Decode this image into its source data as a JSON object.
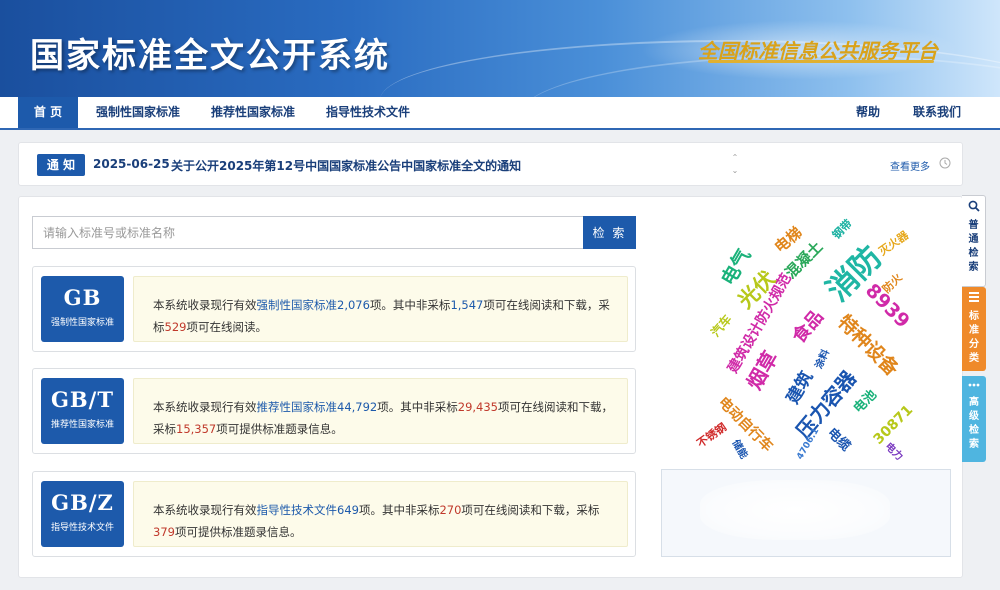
{
  "header": {
    "title": "国家标准全文公开系统",
    "slogan": "全国标准信息公共服务平台"
  },
  "nav": {
    "home": "首  页",
    "mandatory": "强制性国家标准",
    "recommended": "推荐性国家标准",
    "guidance": "指导性技术文件",
    "help": "帮助",
    "contact": "联系我们"
  },
  "notice": {
    "badge": "通  知",
    "date": "2025-06-25",
    "text": "关于公开2025年第12号中国国家标准公告中国家标准全文的通知",
    "more": "查看更多"
  },
  "search": {
    "placeholder": "请输入标准号或标准名称",
    "button": "检 索"
  },
  "cards": [
    {
      "code": "GB",
      "label": "强制性国家标准",
      "p1": "本系统收录现行有效",
      "type": "强制性国家标准",
      "total": "2,076",
      "p2": "项。其中非采标",
      "non_adopted": "1,547",
      "p3": "项可在线阅读和下载，采标",
      "adopted": "529",
      "p4": "项可在线阅读。"
    },
    {
      "code": "GB/T",
      "label": "推荐性国家标准",
      "p1": "本系统收录现行有效",
      "type": "推荐性国家标准",
      "total": "44,792",
      "p2": "项。其中非采标",
      "non_adopted": "29,435",
      "p3": "项可在线阅读和下载，采标",
      "adopted": "15,357",
      "p4": "项可提供标准题录信息。"
    },
    {
      "code": "GB/Z",
      "label": "指导性技术文件",
      "p1": "本系统收录现行有效",
      "type": "指导性技术文件",
      "total": "649",
      "p2": "项。其中非采标",
      "non_adopted": "270",
      "p3": "项可在线阅读和下载，采标",
      "adopted": "379",
      "p4": "项可提供标准题录信息。"
    }
  ],
  "word_cloud": [
    {
      "text": "电气",
      "color": "#1ab27a"
    },
    {
      "text": "电梯",
      "color": "#e0861c"
    },
    {
      "text": "钢带",
      "color": "#17b0a0"
    },
    {
      "text": "灭火器",
      "color": "#e6a81c"
    },
    {
      "text": "光伏",
      "color": "#b7c81a"
    },
    {
      "text": "混凝土",
      "color": "#2aa85a"
    },
    {
      "text": "消防",
      "color": "#1fb6a4"
    },
    {
      "text": "防火",
      "color": "#e0861c"
    },
    {
      "text": "8939",
      "color": "#d02aa8"
    },
    {
      "text": "汽车",
      "color": "#b7c81a"
    },
    {
      "text": "建筑设计防火规范",
      "color": "#d02aa8"
    },
    {
      "text": "食品",
      "color": "#d02aa8"
    },
    {
      "text": "特种设备",
      "color": "#e0861c"
    },
    {
      "text": "烟草",
      "color": "#d02aa8"
    },
    {
      "text": "建筑",
      "color": "#1a55b0"
    },
    {
      "text": "涂料",
      "color": "#1a55b0"
    },
    {
      "text": "压力容器",
      "color": "#1a55b0"
    },
    {
      "text": "电动自行车",
      "color": "#e0861c"
    },
    {
      "text": "电池",
      "color": "#1ab27a"
    },
    {
      "text": "不锈钢",
      "color": "#d02a2a"
    },
    {
      "text": "储能",
      "color": "#1a55b0"
    },
    {
      "text": "4706.1",
      "color": "#3a7ad0"
    },
    {
      "text": "电缆",
      "color": "#1a55b0"
    },
    {
      "text": "30871",
      "color": "#b7c81a"
    },
    {
      "text": "电力",
      "color": "#7a3ac0"
    }
  ],
  "side_tabs": {
    "search": "普通检索",
    "classify": "标准分类",
    "advanced": "高级检索"
  },
  "colors": {
    "primary": "#1d5aab",
    "accent_orange": "#ef8a2a",
    "accent_cyan": "#4fb5e0",
    "number_red": "#c0392b"
  }
}
